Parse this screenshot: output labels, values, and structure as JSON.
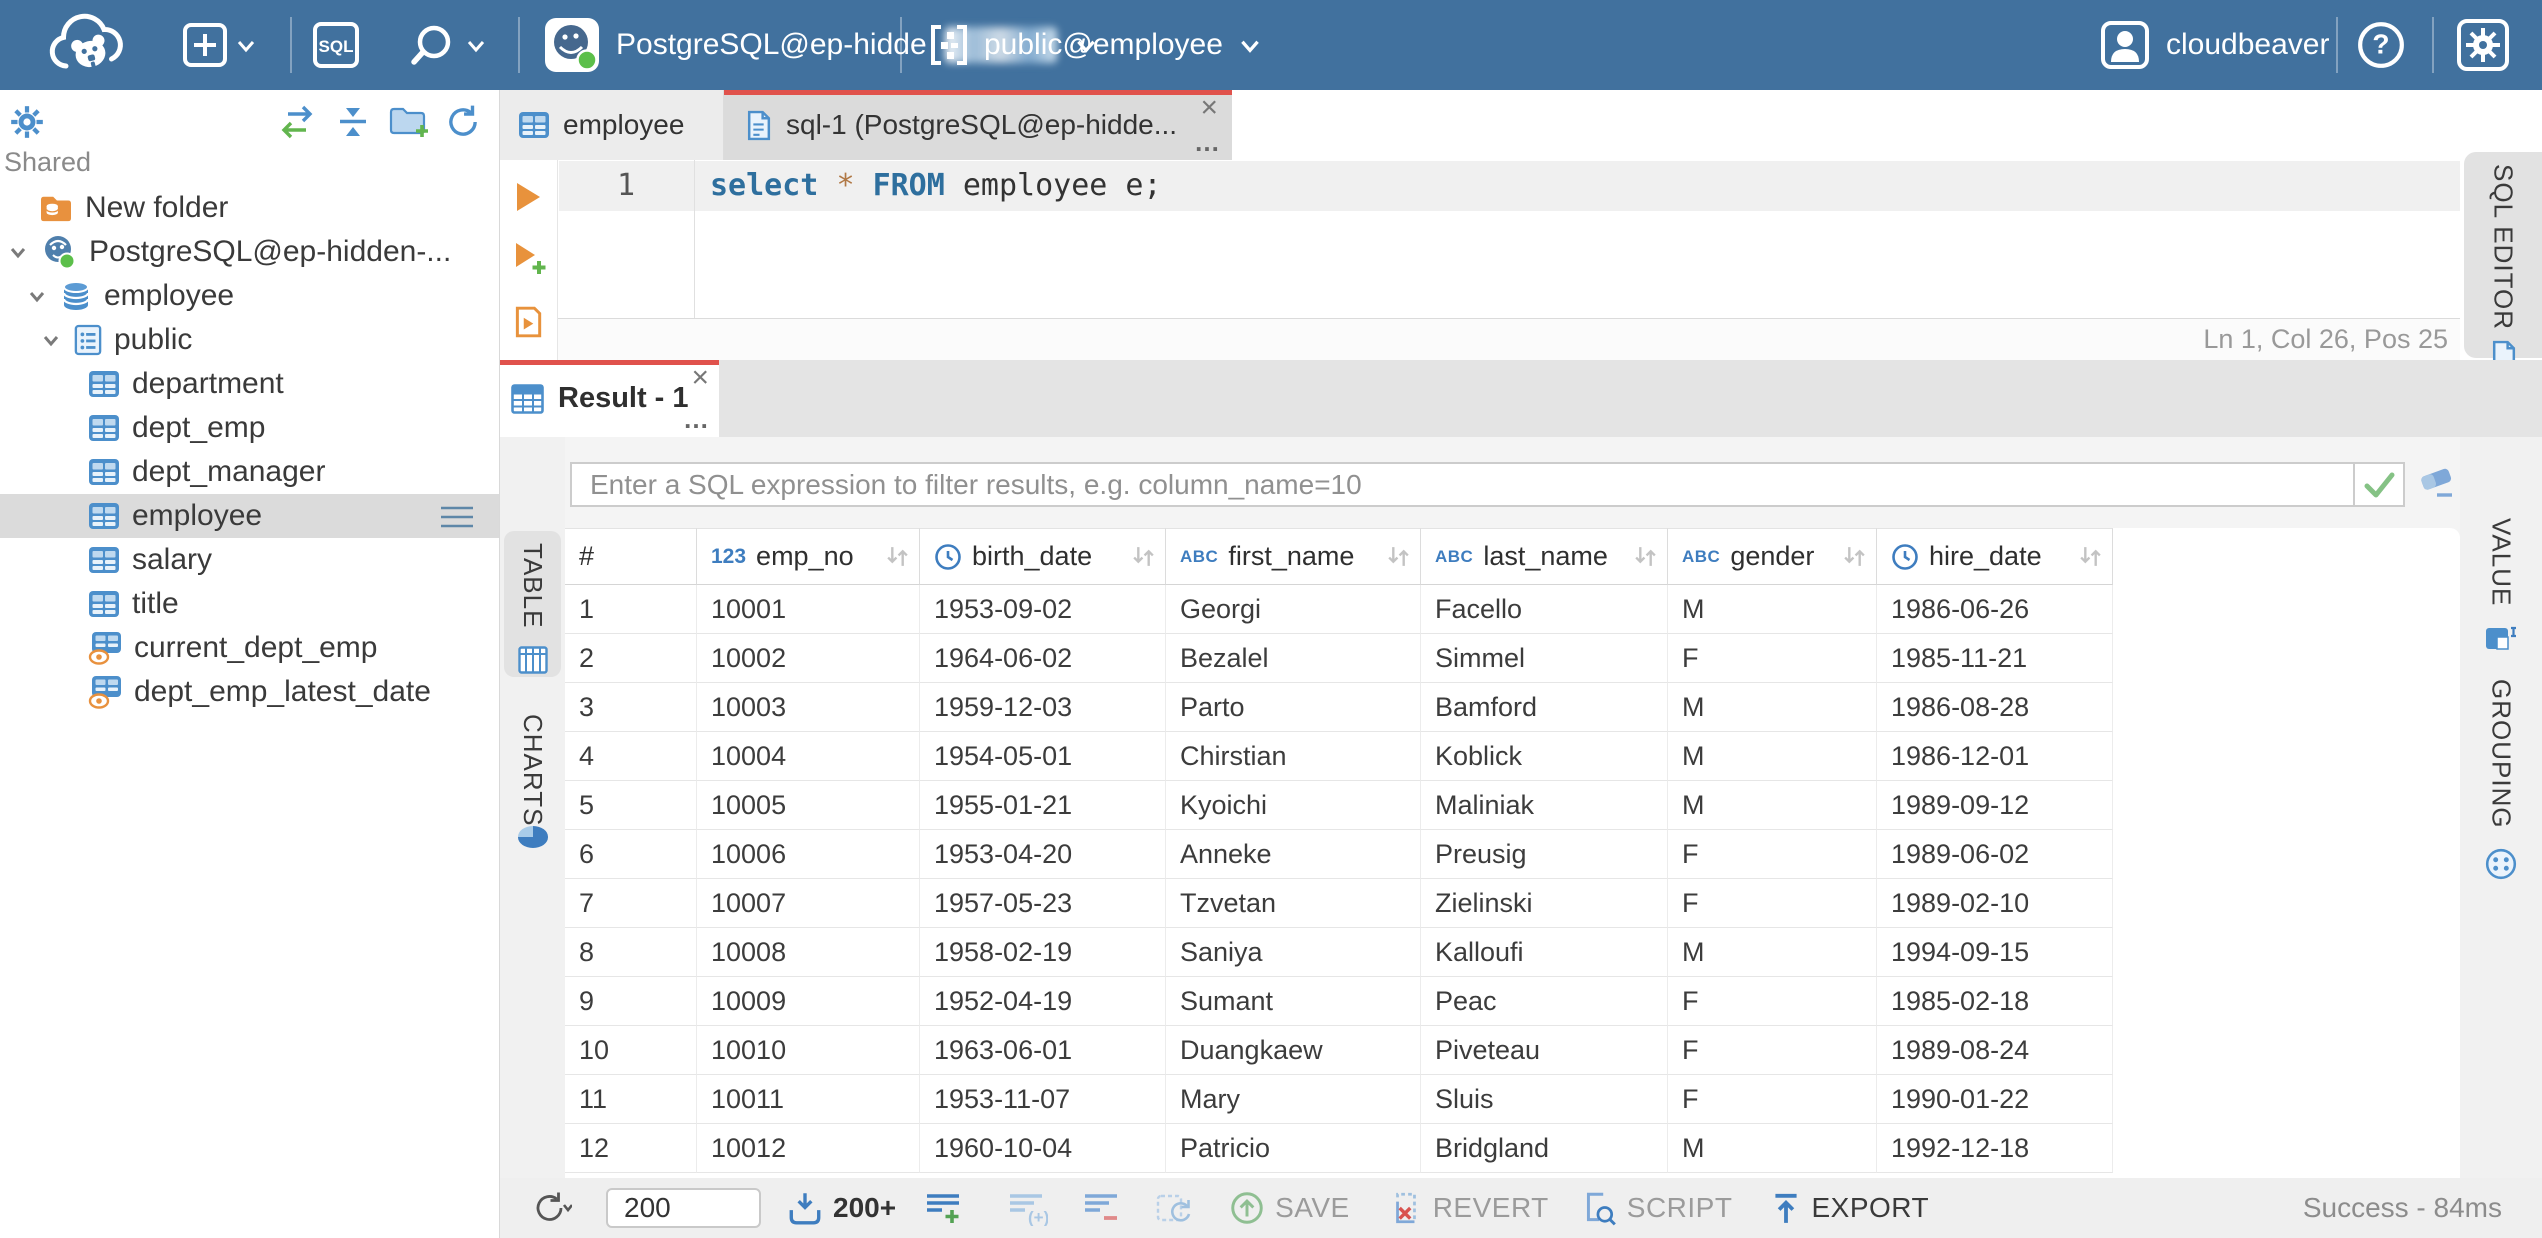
{
  "colors": {
    "header_bg": "#41719E",
    "accent_red": "#E0524C",
    "icon_blue": "#4C8FCB",
    "icon_blue_dark": "#3E7DBF",
    "green": "#5CBF4A",
    "orange": "#E8913E",
    "selection_gray": "#DBDBDB"
  },
  "header": {
    "connection": {
      "label": "PostgreSQL@ep-hidde",
      "redacted": true
    },
    "schema": {
      "label": "public@employee"
    },
    "user": {
      "name": "cloudbeaver"
    }
  },
  "sidebar": {
    "section": "Shared",
    "tree": [
      {
        "label": "New folder",
        "icon": "folderdb",
        "level": 1
      },
      {
        "label": "PostgreSQL@ep-hidden-...",
        "icon": "postgres",
        "level": 1,
        "expanded": true
      },
      {
        "label": "employee",
        "icon": "database",
        "level": 2,
        "expanded": true
      },
      {
        "label": "public",
        "icon": "schema",
        "level": 3,
        "expanded": true
      },
      {
        "label": "department",
        "icon": "table",
        "level": 4
      },
      {
        "label": "dept_emp",
        "icon": "table",
        "level": 4
      },
      {
        "label": "dept_manager",
        "icon": "table",
        "level": 4
      },
      {
        "label": "employee",
        "icon": "table",
        "level": 4,
        "selected": true
      },
      {
        "label": "salary",
        "icon": "table",
        "level": 4
      },
      {
        "label": "title",
        "icon": "table",
        "level": 4
      },
      {
        "label": "current_dept_emp",
        "icon": "view",
        "level": 4
      },
      {
        "label": "dept_emp_latest_date",
        "icon": "view",
        "level": 4
      }
    ]
  },
  "editor_tabs": {
    "employee": {
      "label": "employee"
    },
    "sql": {
      "label": "sql-1 (PostgreSQL@ep-hidde...",
      "close": "×",
      "more": "…"
    }
  },
  "sql": {
    "line_number": "1",
    "tokens": [
      [
        "kw",
        "select"
      ],
      [
        "pl",
        " "
      ],
      [
        "op",
        "*"
      ],
      [
        "pl",
        " "
      ],
      [
        "kw",
        "FROM"
      ],
      [
        "pl",
        " employee e;"
      ]
    ],
    "status": "Ln 1, Col 26, Pos 25",
    "right_tab": "SQL EDITOR"
  },
  "results": {
    "tab": {
      "label": "Result - 1",
      "close": "×",
      "more": "…"
    },
    "filter_placeholder": "Enter a SQL expression to filter results, e.g. column_name=10",
    "left_tabs": {
      "table": "TABLE",
      "charts": "CHARTS"
    },
    "right_tabs": {
      "value": "VALUE",
      "grouping": "GROUPING"
    },
    "grid": {
      "columns": [
        {
          "name": "#",
          "type": ""
        },
        {
          "name": "emp_no",
          "type": "123"
        },
        {
          "name": "birth_date",
          "type": "time"
        },
        {
          "name": "first_name",
          "type": "abc"
        },
        {
          "name": "last_name",
          "type": "abc"
        },
        {
          "name": "gender",
          "type": "abc"
        },
        {
          "name": "hire_date",
          "type": "time"
        }
      ],
      "rows": [
        [
          "1",
          "10001",
          "1953-09-02",
          "Georgi",
          "Facello",
          "M",
          "1986-06-26"
        ],
        [
          "2",
          "10002",
          "1964-06-02",
          "Bezalel",
          "Simmel",
          "F",
          "1985-11-21"
        ],
        [
          "3",
          "10003",
          "1959-12-03",
          "Parto",
          "Bamford",
          "M",
          "1986-08-28"
        ],
        [
          "4",
          "10004",
          "1954-05-01",
          "Chirstian",
          "Koblick",
          "M",
          "1986-12-01"
        ],
        [
          "5",
          "10005",
          "1955-01-21",
          "Kyoichi",
          "Maliniak",
          "M",
          "1989-09-12"
        ],
        [
          "6",
          "10006",
          "1953-04-20",
          "Anneke",
          "Preusig",
          "F",
          "1989-06-02"
        ],
        [
          "7",
          "10007",
          "1957-05-23",
          "Tzvetan",
          "Zielinski",
          "F",
          "1989-02-10"
        ],
        [
          "8",
          "10008",
          "1958-02-19",
          "Saniya",
          "Kalloufi",
          "M",
          "1994-09-15"
        ],
        [
          "9",
          "10009",
          "1952-04-19",
          "Sumant",
          "Peac",
          "F",
          "1985-02-18"
        ],
        [
          "10",
          "10010",
          "1963-06-01",
          "Duangkaew",
          "Piveteau",
          "F",
          "1989-08-24"
        ],
        [
          "11",
          "10011",
          "1953-11-07",
          "Mary",
          "Sluis",
          "F",
          "1990-01-22"
        ],
        [
          "12",
          "10012",
          "1960-10-04",
          "Patricio",
          "Bridgland",
          "M",
          "1992-12-18"
        ]
      ]
    },
    "toolbar": {
      "row_limit": "200",
      "fetch_label": "200+",
      "save": "SAVE",
      "revert": "REVERT",
      "script": "SCRIPT",
      "export": "EXPORT",
      "status": "Success - 84ms"
    }
  }
}
